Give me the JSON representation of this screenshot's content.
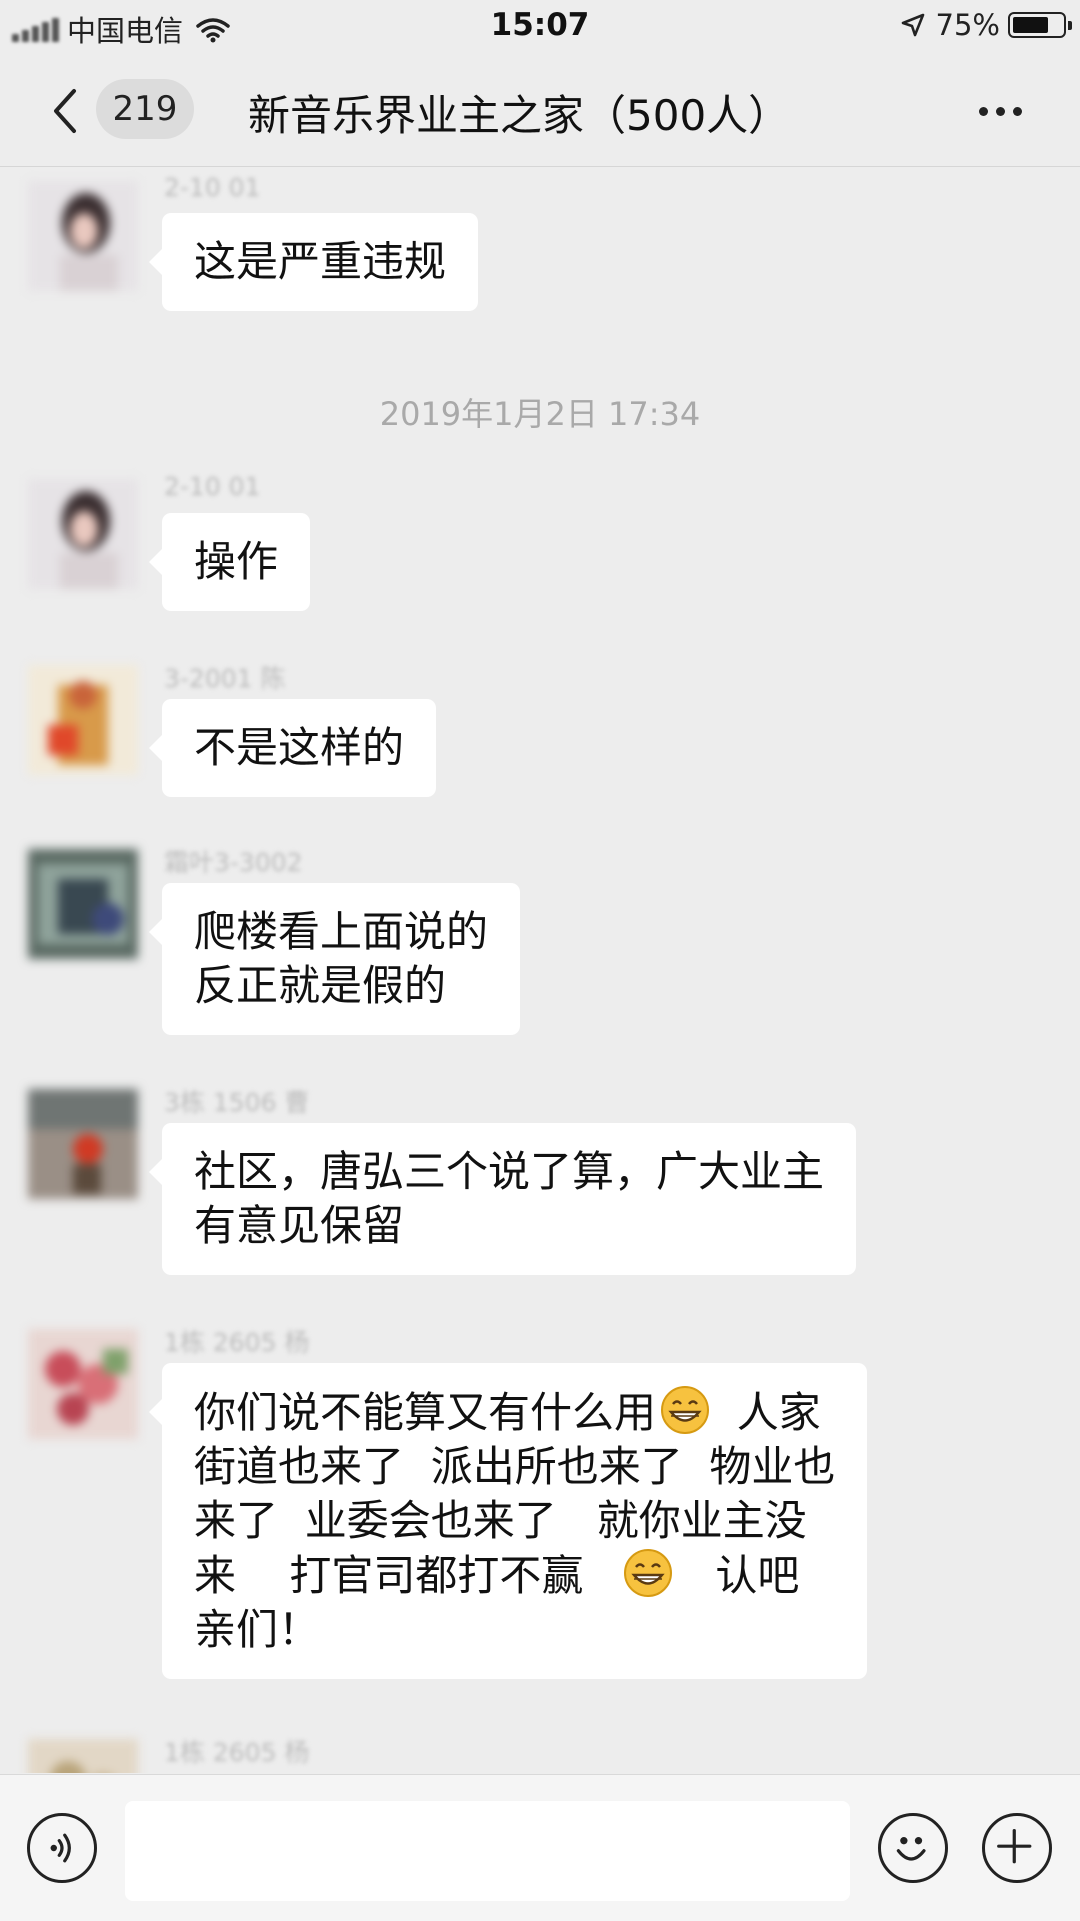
{
  "status_bar": {
    "carrier": "中国电信",
    "time": "15:07",
    "battery_percent": "75%",
    "battery_level": 0.75
  },
  "nav": {
    "unread_count": "219",
    "title": "新音乐界业主之家（500人）"
  },
  "timestamp": "2019年1月2日 17:34",
  "messages": [
    {
      "sender": "2-10 01",
      "lines": [
        "这是严重违规"
      ]
    },
    {
      "sender": "2-10 01",
      "lines": [
        "操作"
      ]
    },
    {
      "sender": "3-2001 陈",
      "lines": [
        "不是这样的"
      ]
    },
    {
      "sender": "霜叶3-3002",
      "lines": [
        "爬楼看上面说的",
        "反正就是假的"
      ]
    },
    {
      "sender": "3栋 1506 曹",
      "lines": [
        "社区，唐弘三个说了算，广大业主",
        "有意见保留"
      ]
    },
    {
      "sender": "1栋 2605 杨",
      "lines": [
        "你们说不能算又有什么用",
        "  人家",
        "街道也来了  派出所也来了  物业也",
        "来了  业委会也来了   就你业主没",
        "来    打官司都打不赢",
        "认吧",
        "亲们！"
      ]
    },
    {
      "sender": "1栋 2605 杨"
    }
  ],
  "icons": {
    "back": "chevron-left-icon",
    "more": "more-dots-icon",
    "voice": "voice-icon",
    "emoji": "emoji-smile-icon",
    "add": "plus-icon",
    "grin": "grinning-emoji"
  },
  "colors": {
    "background": "#ededed",
    "bubble": "#ffffff",
    "input_bar": "#f5f5f5"
  }
}
